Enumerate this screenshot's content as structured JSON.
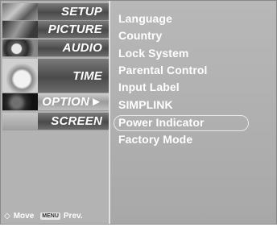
{
  "tabs": [
    {
      "label": "SETUP",
      "icon": "setup-thumbnail-icon"
    },
    {
      "label": "PICTURE",
      "icon": "picture-thumbnail-icon"
    },
    {
      "label": "AUDIO",
      "icon": "audio-thumbnail-icon"
    },
    {
      "label": "TIME",
      "icon": "time-thumbnail-icon"
    },
    {
      "label": "OPTION",
      "icon": "option-thumbnail-icon",
      "active": true,
      "arrow": "►"
    },
    {
      "label": "SCREEN",
      "icon": "screen-thumbnail-icon"
    }
  ],
  "menu_items": [
    "Language",
    "Country",
    "Lock System",
    "Parental Control",
    "Input Label",
    "SIMPLINK",
    "Power Indicator",
    "Factory Mode"
  ],
  "selected_item": "Power Indicator",
  "footer": {
    "move_glyph": "◇",
    "move_label": "Move",
    "menu_key": "MENU",
    "prev_label": "Prev."
  },
  "colors": {
    "panel": "#b3b3b3",
    "text": "#ffffff",
    "active_tab": "#c0c0c0"
  }
}
